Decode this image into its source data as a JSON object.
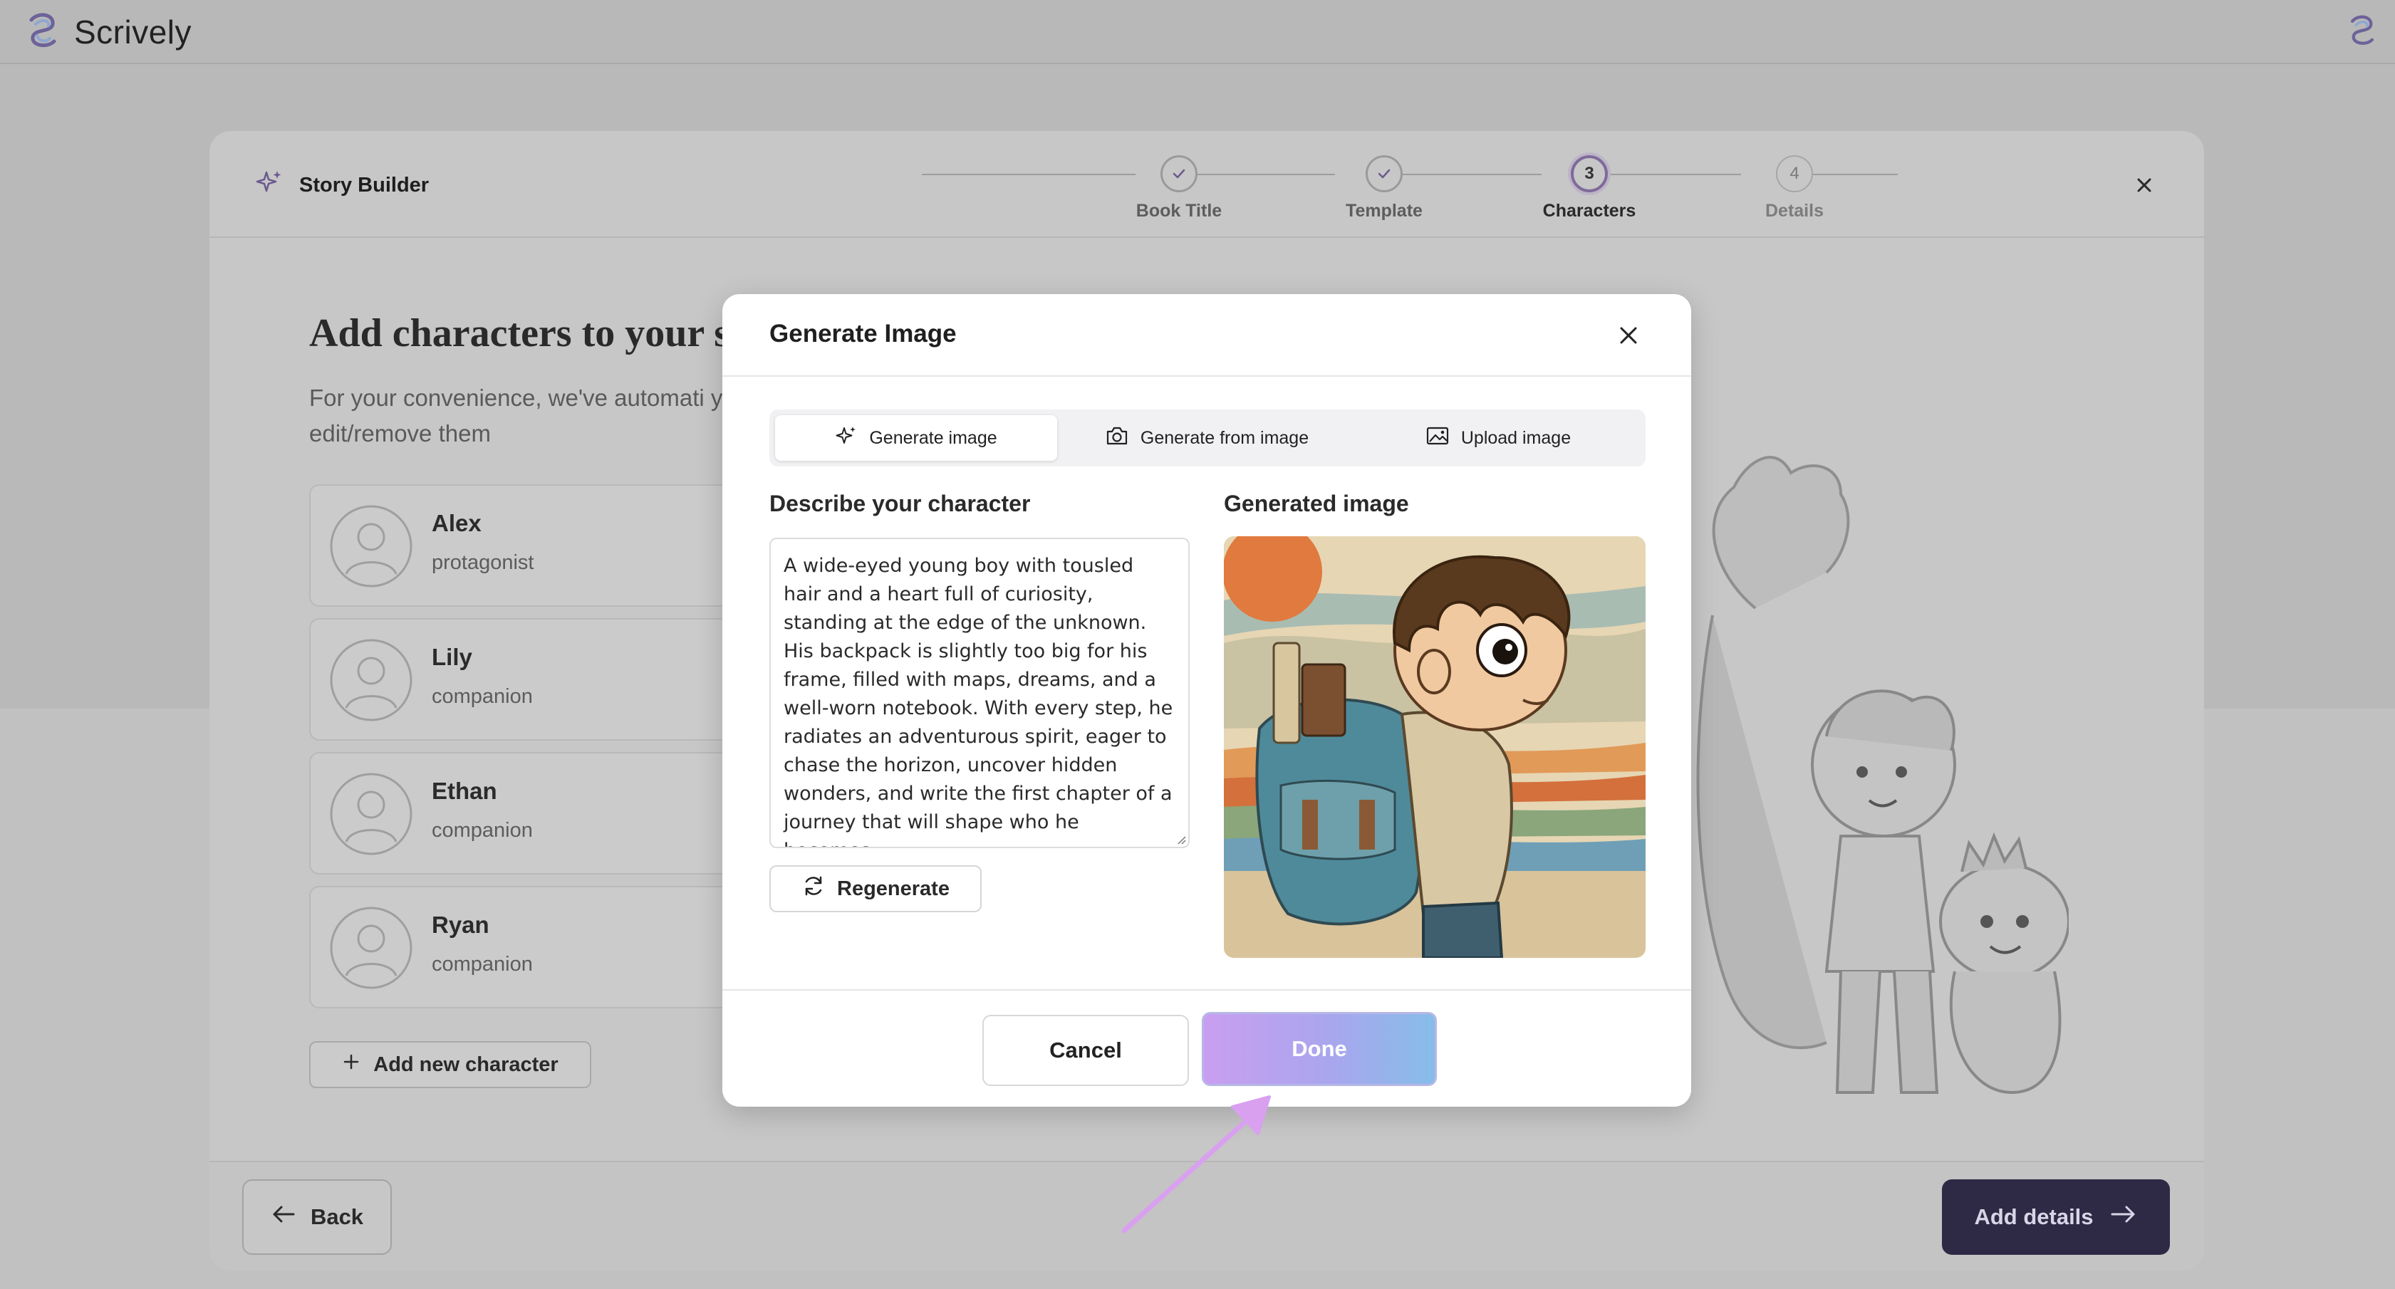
{
  "app": {
    "brand": "Scrively"
  },
  "builder": {
    "title": "Story Builder",
    "steps": [
      {
        "label": "Book Title",
        "state": "done",
        "number": ""
      },
      {
        "label": "Template",
        "state": "done",
        "number": ""
      },
      {
        "label": "Characters",
        "state": "active",
        "number": "3"
      },
      {
        "label": "Details",
        "state": "pending",
        "number": "4"
      }
    ],
    "heading": "Add characters to your s",
    "subtext": "For your convenience, we've automati you, but feel free to edit/remove them",
    "characters": [
      {
        "name": "Alex",
        "role": "protagonist"
      },
      {
        "name": "Lily",
        "role": "companion"
      },
      {
        "name": "Ethan",
        "role": "companion"
      },
      {
        "name": "Ryan",
        "role": "companion"
      }
    ],
    "add_character": "Add new character",
    "back": "Back",
    "add_details": "Add details"
  },
  "modal": {
    "title": "Generate Image",
    "tabs": [
      {
        "label": "Generate image",
        "icon": "sparkle-icon",
        "active": true
      },
      {
        "label": "Generate from image",
        "icon": "camera-icon",
        "active": false
      },
      {
        "label": "Upload image",
        "icon": "image-icon",
        "active": false
      }
    ],
    "describe_label": "Describe your character",
    "description": "A wide-eyed young boy with tousled hair and a heart full of curiosity, standing at the edge of the unknown. His backpack is slightly too big for his frame, filled with maps, dreams, and a well-worn notebook. With every step, he radiates an adventurous spirit, eager to chase the horizon, uncover hidden wonders, and write the first chapter of a journey that will shape who he becomes.",
    "regenerate": "Regenerate",
    "generated_label": "Generated image",
    "cancel": "Cancel",
    "done": "Done"
  },
  "colors": {
    "accent_purple": "#7f6a9a",
    "dark_button": "#2e2a45",
    "done_gradient_start": "#c99ef0",
    "done_gradient_end": "#86bde9",
    "pointer_arrow": "#d9a0f0"
  }
}
